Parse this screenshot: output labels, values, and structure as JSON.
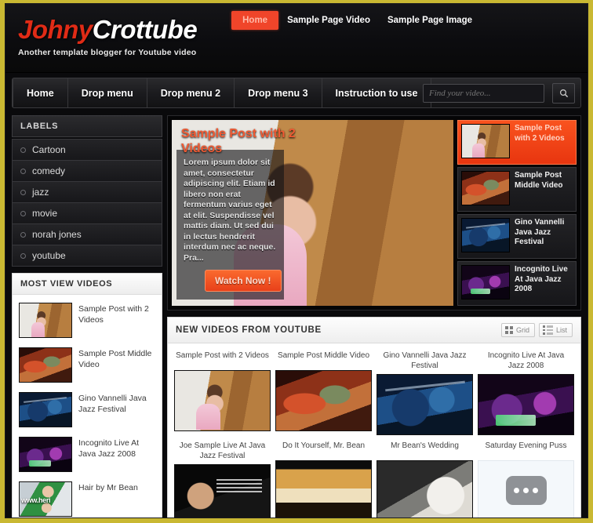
{
  "theme": {
    "page_border": "#c9b832",
    "background": "#0a0a0c",
    "accent": "#f0452a",
    "logo_red": "#e02b16"
  },
  "header": {
    "logo_part1": "Johny",
    "logo_part2": "Crottube",
    "tagline": "Another template blogger for Youtube video",
    "top_links": [
      {
        "label": "Home",
        "active": true
      },
      {
        "label": "Sample Page Video",
        "active": false
      },
      {
        "label": "Sample Page Image",
        "active": false
      }
    ]
  },
  "nav": {
    "items": [
      "Home",
      "Drop menu",
      "Drop menu 2",
      "Drop menu 3",
      "Instruction to use"
    ],
    "search_placeholder": "Find your video...",
    "search_value": "",
    "search_icon": "search-icon"
  },
  "sidebar": {
    "labels_title": "LABELS",
    "labels": [
      "Cartoon",
      "comedy",
      "jazz",
      "movie",
      "norah jones",
      "youtube"
    ],
    "most_view_title": "MOST VIEW VIDEOS",
    "most_view": [
      {
        "title": "Sample Post with 2 Videos",
        "art": "art-girl",
        "watermark": ""
      },
      {
        "title": "Sample Post Middle Video",
        "art": "art-desk",
        "watermark": ""
      },
      {
        "title": "Gino Vannelli Java Jazz Festival",
        "art": "art-drums",
        "watermark": ""
      },
      {
        "title": "Incognito Live At Java Jazz 2008",
        "art": "art-concert",
        "watermark": ""
      },
      {
        "title": "Hair by Mr Bean",
        "art": "art-hair",
        "watermark": "www.heri"
      }
    ]
  },
  "slider": {
    "featured": {
      "title": "Sample Post with 2 Videos",
      "description": "Lorem ipsum dolor sit amet, consectetur adipiscing elit. Etiam id libero non erat fermentum varius eget at elit. Suspendisse vel mattis diam. Ut sed dui in lectus hendrerit interdum nec ac neque. Pra...",
      "button": "Watch Now !",
      "art": "art-girl"
    },
    "tabs": [
      {
        "title": "Sample Post with 2 Videos",
        "art": "art-girl",
        "active": true
      },
      {
        "title": "Sample Post Middle Video",
        "art": "art-desk",
        "active": false
      },
      {
        "title": "Gino Vannelli Java Jazz Festival",
        "art": "art-drums",
        "active": false
      },
      {
        "title": "Incognito Live At Java Jazz 2008",
        "art": "art-concert",
        "active": false
      }
    ]
  },
  "videos": {
    "section_title": "NEW VIDEOS FROM YOUTUBE",
    "view_grid_label": "Grid",
    "view_list_label": "List",
    "grid_icon": "grid-view-icon",
    "list_icon": "list-view-icon",
    "items": [
      {
        "title": "Sample Post with 2 Videos",
        "art": "art-girl",
        "placeholder": false
      },
      {
        "title": "Sample Post Middle Video",
        "art": "art-desk",
        "placeholder": false
      },
      {
        "title": "Gino Vannelli Java Jazz Festival",
        "art": "art-drums",
        "placeholder": false
      },
      {
        "title": "Incognito Live At Java Jazz 2008",
        "art": "art-concert",
        "placeholder": false
      },
      {
        "title": "Joe Sample Live At Java Jazz Festival",
        "art": "art-joe",
        "placeholder": false
      },
      {
        "title": "Do It Yourself, Mr. Bean",
        "art": "art-diy",
        "placeholder": false
      },
      {
        "title": "Mr Bean's Wedding",
        "art": "art-wedding",
        "placeholder": false
      },
      {
        "title": "Saturday Evening Puss",
        "art": "",
        "placeholder": true
      }
    ]
  }
}
